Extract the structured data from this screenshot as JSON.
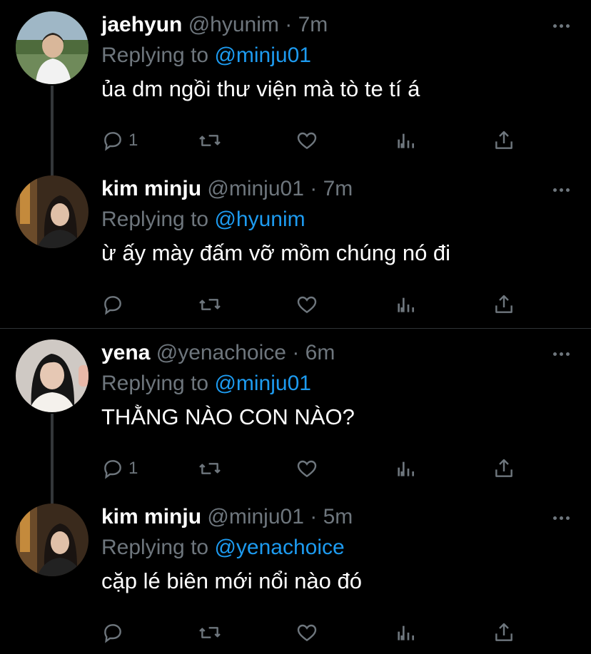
{
  "tweets": [
    {
      "name": "jaehyun",
      "handle": "@hyunim",
      "separator": "·",
      "time": "7m",
      "replying_prefix": "Replying to",
      "replying_to": "@minju01",
      "text": "ủa dm ngồi thư viện mà tò te tí á",
      "reply_count": "1"
    },
    {
      "name": "kim minju",
      "handle": "@minju01",
      "separator": "·",
      "time": "7m",
      "replying_prefix": "Replying to",
      "replying_to": "@hyunim",
      "text": "ừ ấy mày đấm vỡ mồm chúng nó đi",
      "reply_count": ""
    },
    {
      "name": "yena",
      "handle": "@yenachoice",
      "separator": "·",
      "time": "6m",
      "replying_prefix": "Replying to",
      "replying_to": "@minju01",
      "text": "THẰNG NÀO CON NÀO?",
      "reply_count": "1"
    },
    {
      "name": "kim minju",
      "handle": "@minju01",
      "separator": "·",
      "time": "5m",
      "replying_prefix": "Replying to",
      "replying_to": "@yenachoice",
      "text": "cặp lé biên mới nổi nào đó",
      "reply_count": ""
    }
  ],
  "colors": {
    "background": "#000000",
    "name": "#ffffff",
    "secondary": "#6e767d",
    "mention": "#1d9bf0",
    "divider": "#2f3336"
  },
  "icons": [
    "reply-icon",
    "retweet-icon",
    "like-icon",
    "analytics-icon",
    "share-icon",
    "more-icon"
  ]
}
